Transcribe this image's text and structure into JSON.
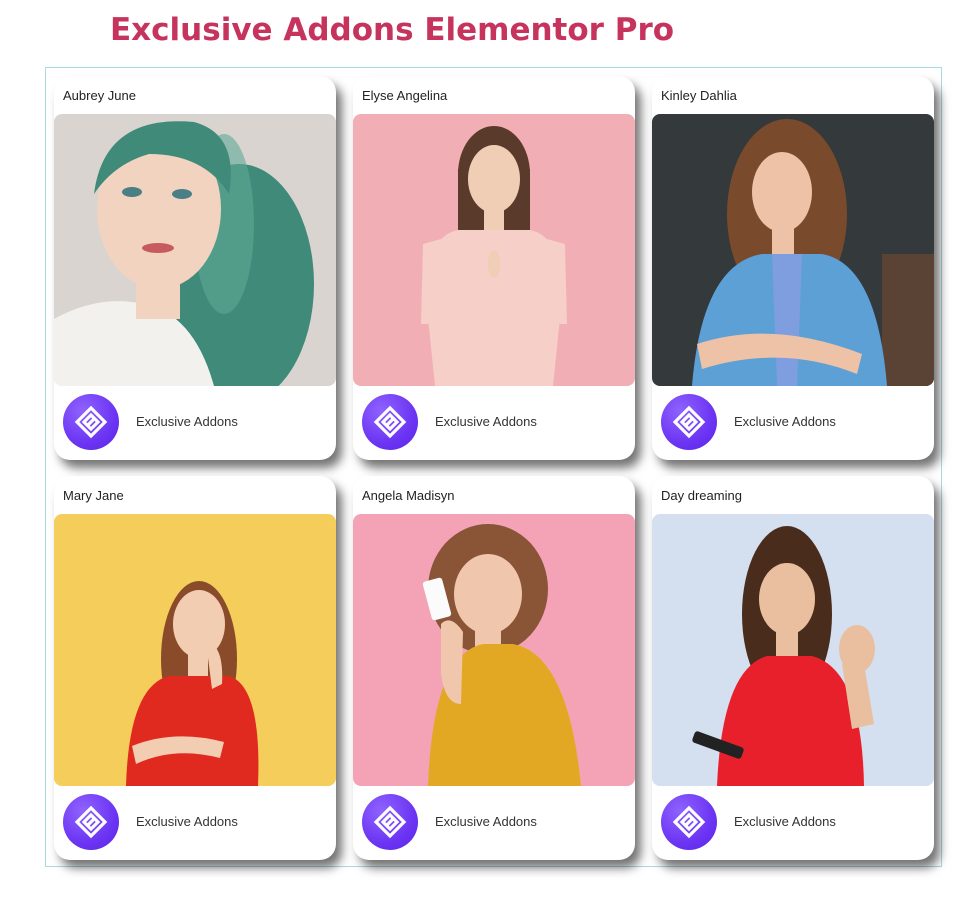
{
  "page": {
    "title": "Exclusive Addons Elementor Pro"
  },
  "cards": [
    {
      "name": "Aubrey June",
      "footer_label": "Exclusive Addons",
      "logo_icon": "exclusive-addons-logo-icon",
      "background": "#d9d4cf",
      "hair": "#3f8a79",
      "top": "#f3f1ed",
      "skin": "#f1d3c0"
    },
    {
      "name": "Elyse Angelina",
      "footer_label": "Exclusive Addons",
      "logo_icon": "exclusive-addons-logo-icon",
      "background": "#f1aeb4",
      "hair": "#5a3a2a",
      "top": "#f5cfc8",
      "skin": "#f0cdb5"
    },
    {
      "name": "Kinley Dahlia",
      "footer_label": "Exclusive Addons",
      "logo_icon": "exclusive-addons-logo-icon",
      "background": "#34393b",
      "hair": "#7a4a2c",
      "top": "#5da0d6",
      "skin": "#eec2a6"
    },
    {
      "name": "Mary Jane",
      "footer_label": "Exclusive Addons",
      "logo_icon": "exclusive-addons-logo-icon",
      "background": "#f4cd5a",
      "hair": "#8a4b2a",
      "top": "#e02a1f",
      "skin": "#f2cdb2"
    },
    {
      "name": "Angela Madisyn",
      "footer_label": "Exclusive Addons",
      "logo_icon": "exclusive-addons-logo-icon",
      "background": "#f3a3b5",
      "hair": "#8a5436",
      "top": "#e3a823",
      "skin": "#f0c7ad"
    },
    {
      "name": "Day dreaming",
      "footer_label": "Exclusive Addons",
      "logo_icon": "exclusive-addons-logo-icon",
      "background": "#d4dff0",
      "hair": "#4a2c1c",
      "top": "#e8202b",
      "skin": "#eabf9f"
    }
  ]
}
